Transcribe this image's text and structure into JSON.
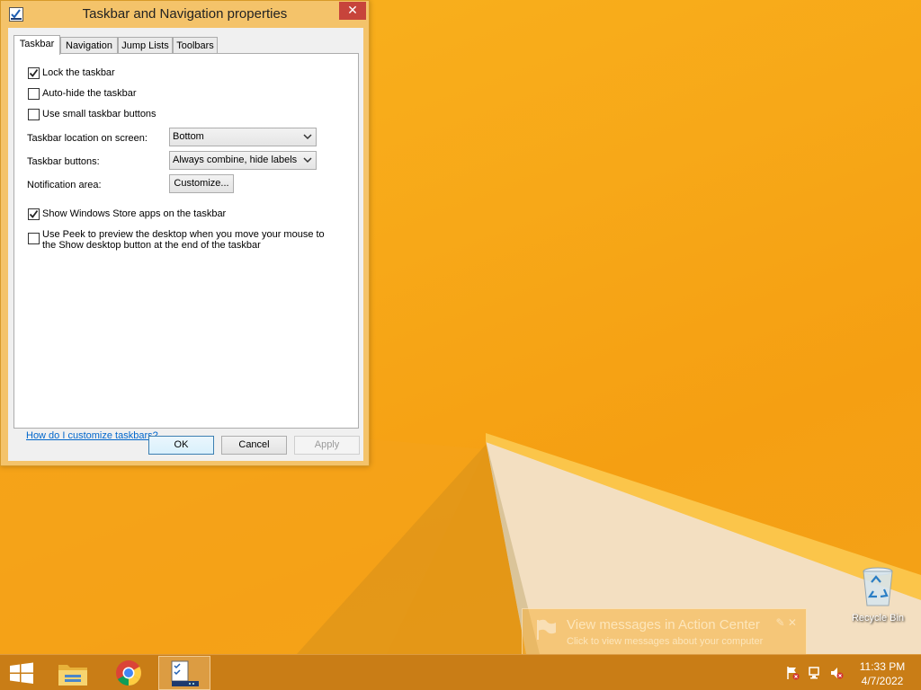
{
  "window": {
    "title": "Taskbar and Navigation properties",
    "close_glyph": "✕"
  },
  "tabs": [
    {
      "label": "Taskbar",
      "selected": true
    },
    {
      "label": "Navigation",
      "selected": false
    },
    {
      "label": "Jump Lists",
      "selected": false
    },
    {
      "label": "Toolbars",
      "selected": false
    }
  ],
  "taskbar_tab": {
    "options": [
      {
        "label": "Lock the taskbar",
        "checked": true
      },
      {
        "label": "Auto-hide the taskbar",
        "checked": false
      },
      {
        "label": "Use small taskbar buttons",
        "checked": false
      }
    ],
    "location_label": "Taskbar location on screen:",
    "location_value": "Bottom",
    "buttons_label": "Taskbar buttons:",
    "buttons_value": "Always combine, hide labels",
    "notification_label": "Notification area:",
    "customize_button": "Customize...",
    "store_apps": {
      "label": "Show Windows Store apps on the taskbar",
      "checked": true
    },
    "peek": {
      "label": "Use Peek to preview the desktop when you move your mouse to the Show desktop button at the end of the taskbar",
      "checked": false
    },
    "help_link": "How do I customize taskbars?"
  },
  "dialog_buttons": {
    "ok": "OK",
    "cancel": "Cancel",
    "apply": "Apply"
  },
  "desktop": {
    "recycle_bin_label": "Recycle Bin"
  },
  "toast": {
    "title": "View messages in Action Center",
    "subtitle": "Click to view messages about your computer"
  },
  "taskbar": {
    "pinned": [
      {
        "name": "start-button",
        "icon": "windows-logo-icon"
      },
      {
        "name": "file-explorer",
        "icon": "folder-icon"
      },
      {
        "name": "chrome",
        "icon": "chrome-icon"
      },
      {
        "name": "taskbar-properties",
        "icon": "properties-icon",
        "active": true
      }
    ],
    "tray_icons": [
      "action-center-flag-icon",
      "network-icon",
      "volume-muted-icon"
    ],
    "time": "11:33 PM",
    "date": "4/7/2022"
  },
  "colors": {
    "accent": "#f6a81c",
    "taskbar": "#c47a16",
    "close_button": "#c7443b",
    "link": "#0066cc"
  }
}
